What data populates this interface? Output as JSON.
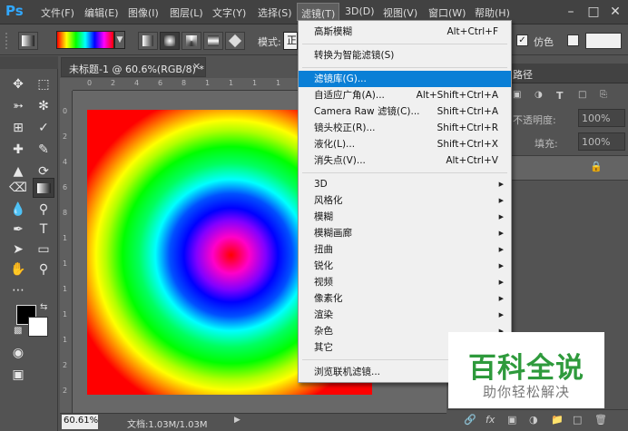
{
  "app": {
    "logo": "Ps"
  },
  "menubar": {
    "items": [
      "文件(F)",
      "编辑(E)",
      "图像(I)",
      "图层(L)",
      "文字(Y)",
      "选择(S)",
      "滤镜(T)",
      "3D(D)",
      "视图(V)",
      "窗口(W)",
      "帮助(H)"
    ],
    "active": "滤镜(T)"
  },
  "optionsbar": {
    "mode_label": "模式:",
    "mode_value": "正",
    "fake_label": "仿色",
    "gradient_colors": [
      "#ff0000",
      "#ffff00",
      "#00ff00",
      "#00ffff",
      "#0000ff",
      "#ff00ff"
    ]
  },
  "document": {
    "tab_title": "未标题-1 @ 60.6%(RGB/8) *",
    "zoom": "60.61%",
    "info": "文档:1.03M/1.03M"
  },
  "rulers": {
    "top": [
      "0",
      "2",
      "4",
      "6",
      "8",
      "1",
      "1",
      "1",
      "1",
      "1",
      "2",
      "2"
    ],
    "left": [
      "0",
      "2",
      "4",
      "6",
      "8",
      "1",
      "1",
      "1",
      "1",
      "1",
      "2",
      "2"
    ]
  },
  "filter_menu": {
    "group1": [
      {
        "label": "高斯模糊",
        "shortcut": "Alt+Ctrl+F"
      }
    ],
    "group2": [
      {
        "label": "转换为智能滤镜(S)"
      }
    ],
    "group3": [
      {
        "label": "滤镜库(G)...",
        "highlighted": true
      },
      {
        "label": "自适应广角(A)...",
        "shortcut": "Alt+Shift+Ctrl+A"
      },
      {
        "label": "Camera Raw 滤镜(C)...",
        "shortcut": "Shift+Ctrl+A"
      },
      {
        "label": "镜头校正(R)...",
        "shortcut": "Shift+Ctrl+R"
      },
      {
        "label": "液化(L)...",
        "shortcut": "Shift+Ctrl+X"
      },
      {
        "label": "消失点(V)...",
        "shortcut": "Alt+Ctrl+V"
      }
    ],
    "group4": [
      {
        "label": "3D"
      },
      {
        "label": "风格化"
      },
      {
        "label": "模糊"
      },
      {
        "label": "模糊画廊"
      },
      {
        "label": "扭曲"
      },
      {
        "label": "锐化"
      },
      {
        "label": "视频"
      },
      {
        "label": "像素化"
      },
      {
        "label": "渲染"
      },
      {
        "label": "杂色"
      },
      {
        "label": "其它"
      }
    ],
    "group5": [
      {
        "label": "浏览联机滤镜..."
      }
    ]
  },
  "layers_panel": {
    "tab_label": "路径",
    "opacity_label": "不透明度:",
    "opacity_value": "100%",
    "fill_label": "填充:",
    "fill_value": "100%"
  },
  "watermark": {
    "title": "百科全说",
    "subtitle": "助你轻松解决"
  },
  "colors": {
    "accent": "#0a7fd6",
    "ps_blue": "#31a8ff",
    "watermark_green": "#2e9a3c"
  },
  "icons": {
    "toolbar": [
      "move-icon",
      "marquee-icon",
      "lasso-icon",
      "quick-select-icon",
      "crop-icon",
      "eyedropper-icon",
      "healing-brush-icon",
      "brush-icon",
      "clone-stamp-icon",
      "history-brush-icon",
      "eraser-icon",
      "gradient-icon",
      "blur-icon",
      "dodge-icon",
      "pen-icon",
      "type-icon",
      "path-select-icon",
      "rectangle-icon",
      "hand-icon",
      "zoom-icon",
      "more-tools-icon"
    ]
  }
}
